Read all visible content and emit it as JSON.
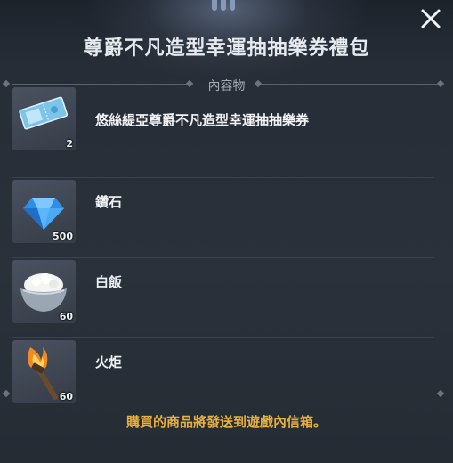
{
  "dialog": {
    "title": "尊爵不凡造型幸運抽抽樂券禮包",
    "contents_label": "內容物",
    "notice": "購買的商品將發送到遊戲內信箱。"
  },
  "items": [
    {
      "name": "悠絲緹亞尊爵不凡造型幸運抽抽樂券",
      "quantity": "2",
      "icon": "ticket-icon"
    },
    {
      "name": "鑽石",
      "quantity": "500",
      "icon": "diamond-icon"
    },
    {
      "name": "白飯",
      "quantity": "60",
      "icon": "rice-bowl-icon"
    },
    {
      "name": "火炬",
      "quantity": "60",
      "icon": "torch-icon"
    }
  ],
  "colors": {
    "background": "#272d36",
    "notice": "#e8b13c",
    "divider": "#5a626e"
  }
}
